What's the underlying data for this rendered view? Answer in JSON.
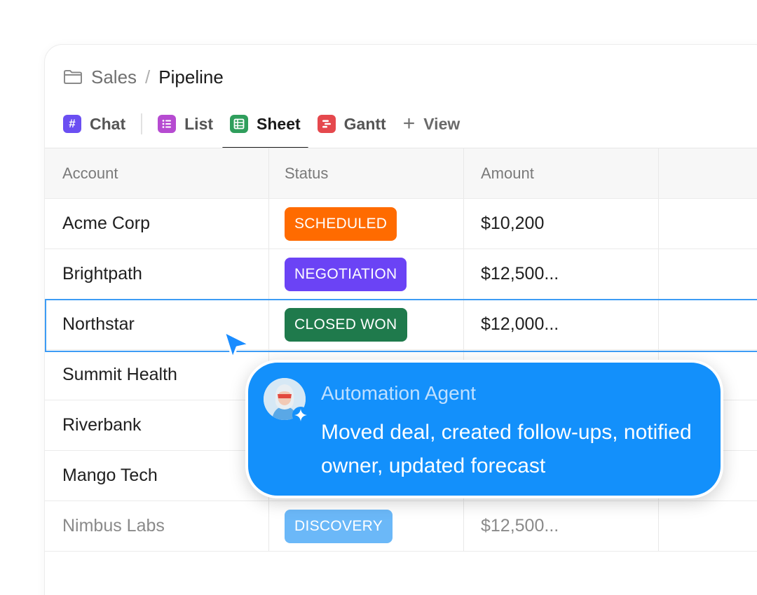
{
  "breadcrumb": {
    "parent": "Sales",
    "separator": "/",
    "current": "Pipeline"
  },
  "tabs": [
    {
      "label": "Chat",
      "icon": "hash-icon",
      "icon_glyph": "#",
      "color": "#6b4ff2"
    },
    {
      "label": "List",
      "icon": "list-icon",
      "color": "#b64bd1"
    },
    {
      "label": "Sheet",
      "icon": "table-icon",
      "color": "#2f9e5c",
      "active": true
    },
    {
      "label": "Gantt",
      "icon": "gantt-icon",
      "color": "#e5484d"
    },
    {
      "label": "View",
      "icon": "plus-icon",
      "icon_glyph": "+"
    }
  ],
  "table": {
    "columns": [
      "Account",
      "Status",
      "Amount",
      ""
    ],
    "rows": [
      {
        "account": "Acme Corp",
        "status": "SCHEDULED",
        "status_color": "#ff6b00",
        "amount": "$10,200"
      },
      {
        "account": "Brightpath",
        "status": "NEGOTIATION",
        "status_color": "#6b43f5",
        "amount": "$12,500..."
      },
      {
        "account": "Northstar",
        "status": "CLOSED WON",
        "status_color": "#1f7a4c",
        "amount": "$12,000...",
        "selected": true
      },
      {
        "account": "Summit Health",
        "status": "",
        "amount": ""
      },
      {
        "account": "Riverbank",
        "status": "",
        "amount": ""
      },
      {
        "account": "Mango Tech",
        "status": "",
        "amount": ""
      },
      {
        "account": "Nimbus Labs",
        "status": "DISCOVERY",
        "status_color": "#6bb8f8",
        "amount": "$12,500...",
        "muted": true
      }
    ]
  },
  "agent": {
    "name": "Automation Agent",
    "message": "Moved deal, created follow-ups, notified owner, updated forecast",
    "card_color": "#1390fb",
    "avatar": "agent-avatar",
    "badge_icon": "sparkle-icon"
  },
  "cursor": {
    "icon": "pointer-cursor-icon",
    "color": "#1a8cff"
  }
}
